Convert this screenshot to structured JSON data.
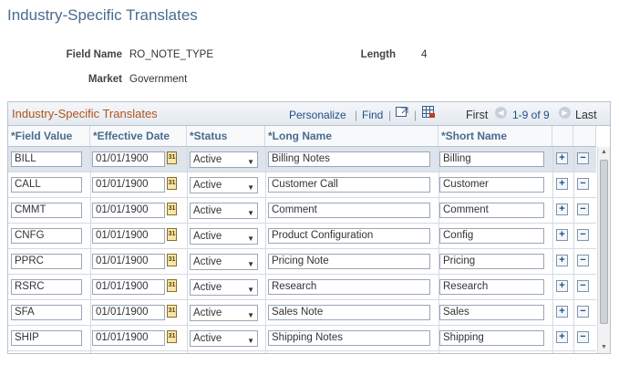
{
  "page": {
    "title": "Industry-Specific Translates"
  },
  "fields": {
    "field_name_label": "Field Name",
    "field_name_value": "RO_NOTE_TYPE",
    "length_label": "Length",
    "length_value": "4",
    "market_label": "Market",
    "market_value": "Government"
  },
  "grid": {
    "title": "Industry-Specific Translates",
    "personalize": "Personalize",
    "find": "Find",
    "first": "First",
    "range": "1-9 of 9",
    "last": "Last",
    "columns": {
      "field_value": "*Field Value",
      "effective_date": "*Effective Date",
      "status": "*Status",
      "long_name": "*Long Name",
      "short_name": "*Short Name"
    },
    "add_label": "+",
    "delete_label": "−",
    "calendar_glyph": "31",
    "rows": [
      {
        "field_value": "BILL",
        "effective_date": "01/01/1900",
        "status": "Active",
        "long_name": "Billing Notes",
        "short_name": "Billing"
      },
      {
        "field_value": "CALL",
        "effective_date": "01/01/1900",
        "status": "Active",
        "long_name": "Customer Call",
        "short_name": "Customer"
      },
      {
        "field_value": "CMMT",
        "effective_date": "01/01/1900",
        "status": "Active",
        "long_name": "Comment",
        "short_name": "Comment"
      },
      {
        "field_value": "CNFG",
        "effective_date": "01/01/1900",
        "status": "Active",
        "long_name": "Product Configuration",
        "short_name": "Config"
      },
      {
        "field_value": "PPRC",
        "effective_date": "01/01/1900",
        "status": "Active",
        "long_name": "Pricing Note",
        "short_name": "Pricing"
      },
      {
        "field_value": "RSRC",
        "effective_date": "01/01/1900",
        "status": "Active",
        "long_name": "Research",
        "short_name": "Research"
      },
      {
        "field_value": "SFA",
        "effective_date": "01/01/1900",
        "status": "Active",
        "long_name": "Sales Note",
        "short_name": "Sales"
      },
      {
        "field_value": "SHIP",
        "effective_date": "01/01/1900",
        "status": "Active",
        "long_name": "Shipping Notes",
        "short_name": "Shipping"
      }
    ]
  },
  "colors": {
    "title_blue": "#4a6b8f",
    "grid_title_orange": "#b4521d",
    "link_blue": "#1f4f85"
  }
}
